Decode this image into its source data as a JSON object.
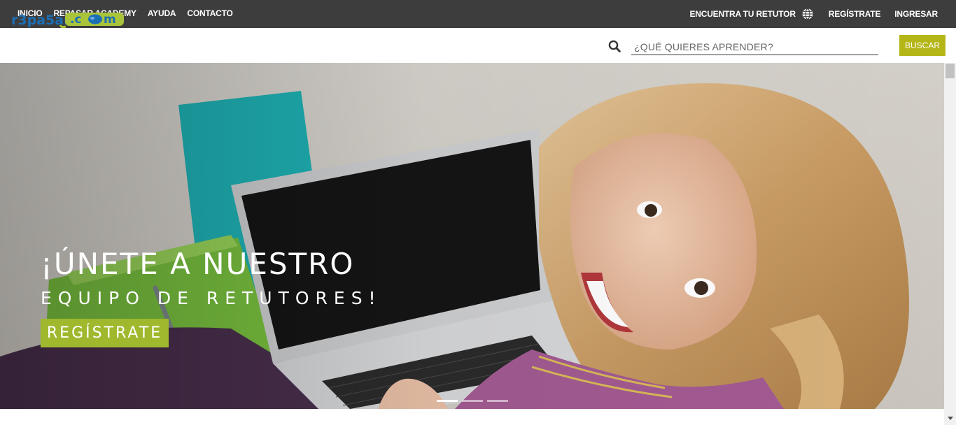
{
  "topbar": {
    "nav": [
      "INICIO",
      "REPASAR ACADEMY",
      "AYUDA",
      "CONTACTO"
    ],
    "find_tutor": "ENCUENTRA TU RETUTOR",
    "register": "REGÍSTRATE",
    "login": "INGRESAR"
  },
  "header": {
    "logo_text": "r3pa5ar.com",
    "search_placeholder": "¿QUÉ QUIERES APRENDER?",
    "search_button": "BUSCAR"
  },
  "hero": {
    "title": "¡ÚNETE A NUESTRO",
    "subtitle": "EQUIPO DE RETUTORES!",
    "cta": "REGÍSTRATE",
    "slides": 3,
    "active_slide": 1
  },
  "colors": {
    "topbar": "#3d3d3d",
    "accent": "#b4b617",
    "hero_button": "#9fb82d",
    "logo_blue": "#1b6fb5"
  },
  "icons": [
    "globe-icon",
    "search-icon",
    "scroll-down-icon"
  ]
}
